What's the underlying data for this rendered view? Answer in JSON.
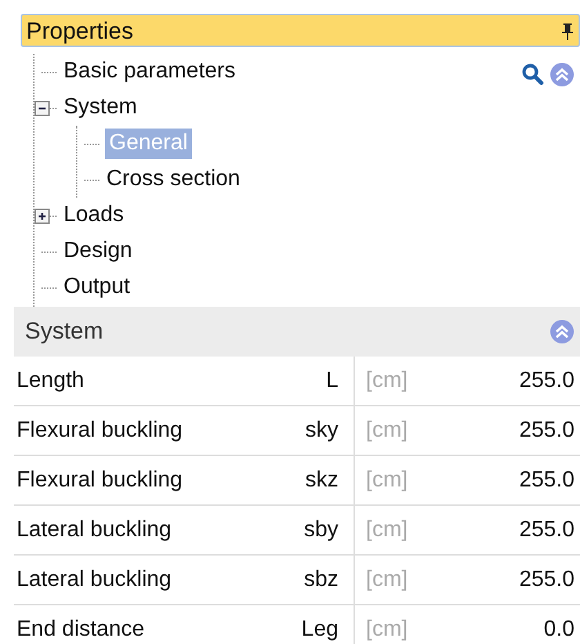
{
  "panel": {
    "title": "Properties"
  },
  "tree": [
    {
      "label": "Basic parameters",
      "selected": false
    },
    {
      "label": "System",
      "selected": false,
      "expanded": true,
      "children": [
        {
          "label": "General",
          "selected": true
        },
        {
          "label": "Cross section",
          "selected": false
        }
      ]
    },
    {
      "label": "Loads",
      "selected": false,
      "expanded": false
    },
    {
      "label": "Design",
      "selected": false
    },
    {
      "label": "Output",
      "selected": false
    }
  ],
  "section": {
    "title": "System"
  },
  "rows": [
    {
      "name": "Length",
      "symbol": "L",
      "unit": "[cm]",
      "value": "255.0"
    },
    {
      "name": "Flexural buckling",
      "symbol": "sky",
      "unit": "[cm]",
      "value": "255.0"
    },
    {
      "name": "Flexural buckling",
      "symbol": "skz",
      "unit": "[cm]",
      "value": "255.0"
    },
    {
      "name": "Lateral buckling",
      "symbol": "sby",
      "unit": "[cm]",
      "value": "255.0"
    },
    {
      "name": "Lateral buckling",
      "symbol": "sbz",
      "unit": "[cm]",
      "value": "255.0"
    },
    {
      "name": "End distance",
      "symbol": "Leg",
      "unit": "[cm]",
      "value": "0.0"
    }
  ]
}
